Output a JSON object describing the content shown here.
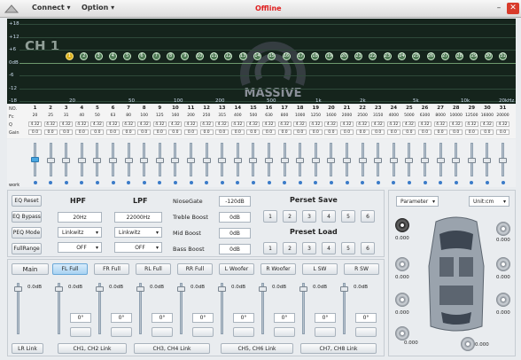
{
  "menu": {
    "connect": "Connect",
    "option": "Option",
    "status": "Offline",
    "minimize": "–",
    "close": "✕"
  },
  "graph": {
    "channel": "CH 1",
    "watermark": "MASSIVE",
    "y_labels": [
      "+18",
      "+12",
      "+6",
      "0dB",
      "-6",
      "-12",
      "-18"
    ],
    "x_labels": [
      "20",
      "50",
      "100",
      "200",
      "500",
      "1k",
      "2k",
      "5k",
      "10k",
      "20kHz"
    ],
    "bands": [
      "1",
      "2",
      "3",
      "4",
      "5",
      "6",
      "7",
      "8",
      "9",
      "10",
      "11",
      "12",
      "13",
      "14",
      "15",
      "16",
      "17",
      "18",
      "19",
      "20",
      "21",
      "22",
      "23",
      "24",
      "25",
      "26",
      "27",
      "28",
      "29",
      "30",
      "31"
    ]
  },
  "table": {
    "row_labels": [
      "NO.",
      "Fc",
      "Q",
      "Gain"
    ],
    "fc": [
      "20",
      "25",
      "31",
      "40",
      "50",
      "63",
      "80",
      "100",
      "125",
      "160",
      "200",
      "250",
      "315",
      "400",
      "500",
      "630",
      "800",
      "1000",
      "1250",
      "1600",
      "2000",
      "2500",
      "3150",
      "4000",
      "5000",
      "6300",
      "8000",
      "10000",
      "12500",
      "16000",
      "20000"
    ],
    "q": "4.32",
    "gain": "0.0"
  },
  "fader_label": "work",
  "eq_buttons": [
    "EQ Reset",
    "EQ Bypass",
    "PEQ Mode",
    "FullRange"
  ],
  "hpf": {
    "title": "HPF",
    "freq": "20Hz",
    "type": "Linkwitz",
    "slope": "OFF"
  },
  "lpf": {
    "title": "LPF",
    "freq": "22000Hz",
    "type": "Linkwitz",
    "slope": "OFF"
  },
  "effects": [
    {
      "label": "NioseGate",
      "value": "-120dB"
    },
    {
      "label": "Treble Boost",
      "value": "0dB"
    },
    {
      "label": "Mid Boost",
      "value": "0dB"
    },
    {
      "label": "Bass Boost",
      "value": "0dB"
    }
  ],
  "preset": {
    "save_title": "Perset Save",
    "load_title": "Preset Load",
    "slots": [
      "1",
      "2",
      "3",
      "4",
      "5",
      "6"
    ]
  },
  "right": {
    "parameter": "Parameter",
    "unit": "Unit:cm",
    "values": [
      "0.000",
      "0.000",
      "0.000",
      "0.000",
      "0.000",
      "0.000",
      "0.000",
      "0.000"
    ]
  },
  "channels": {
    "main": "Main",
    "tabs": [
      "FL Full",
      "FR Full",
      "RL Full",
      "RR Full",
      "L Woofer",
      "R Woofer",
      "L SW",
      "R SW"
    ],
    "gain": "0.0dB",
    "delay": "0°",
    "links": [
      "LR Link",
      "CH1, CH2  Link",
      "CH3, CH4  Link",
      "CH5, CH6  Link",
      "CH7, CH8  Link"
    ]
  }
}
